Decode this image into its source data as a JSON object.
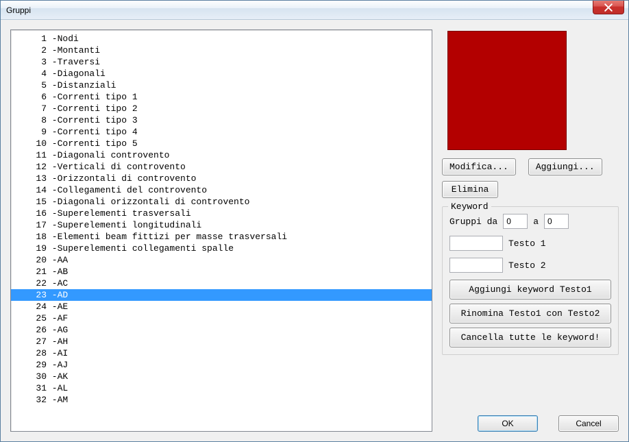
{
  "window": {
    "title": "Gruppi"
  },
  "list": {
    "items": [
      {
        "n": 1,
        "label": "-Nodi",
        "selected": false
      },
      {
        "n": 2,
        "label": "-Montanti",
        "selected": false
      },
      {
        "n": 3,
        "label": "-Traversi",
        "selected": false
      },
      {
        "n": 4,
        "label": "-Diagonali",
        "selected": false
      },
      {
        "n": 5,
        "label": "-Distanziali",
        "selected": false
      },
      {
        "n": 6,
        "label": "-Correnti tipo 1",
        "selected": false
      },
      {
        "n": 7,
        "label": "-Correnti tipo 2",
        "selected": false
      },
      {
        "n": 8,
        "label": "-Correnti tipo 3",
        "selected": false
      },
      {
        "n": 9,
        "label": "-Correnti tipo 4",
        "selected": false
      },
      {
        "n": 10,
        "label": "-Correnti tipo 5",
        "selected": false
      },
      {
        "n": 11,
        "label": "-Diagonali controvento",
        "selected": false
      },
      {
        "n": 12,
        "label": "-Verticali di controvento",
        "selected": false
      },
      {
        "n": 13,
        "label": "-Orizzontali di controvento",
        "selected": false
      },
      {
        "n": 14,
        "label": "-Collegamenti del controvento",
        "selected": false
      },
      {
        "n": 15,
        "label": "-Diagonali orizzontali di controvento",
        "selected": false
      },
      {
        "n": 16,
        "label": "-Superelementi trasversali",
        "selected": false
      },
      {
        "n": 17,
        "label": "-Superelementi longitudinali",
        "selected": false
      },
      {
        "n": 18,
        "label": "-Elementi beam fittizi per masse trasversali",
        "selected": false
      },
      {
        "n": 19,
        "label": "-Superelementi collegamenti spalle",
        "selected": false
      },
      {
        "n": 20,
        "label": "-AA",
        "selected": false
      },
      {
        "n": 21,
        "label": "-AB",
        "selected": false
      },
      {
        "n": 22,
        "label": "-AC",
        "selected": false
      },
      {
        "n": 23,
        "label": "-AD",
        "selected": true
      },
      {
        "n": 24,
        "label": "-AE",
        "selected": false
      },
      {
        "n": 25,
        "label": "-AF",
        "selected": false
      },
      {
        "n": 26,
        "label": "-AG",
        "selected": false
      },
      {
        "n": 27,
        "label": "-AH",
        "selected": false
      },
      {
        "n": 28,
        "label": "-AI",
        "selected": false
      },
      {
        "n": 29,
        "label": "-AJ",
        "selected": false
      },
      {
        "n": 30,
        "label": "-AK",
        "selected": false
      },
      {
        "n": 31,
        "label": "-AL",
        "selected": false
      },
      {
        "n": 32,
        "label": "-AM",
        "selected": false
      }
    ]
  },
  "color_swatch": "#b30000",
  "buttons": {
    "modify": "Modifica...",
    "add": "Aggiungi...",
    "delete": "Elimina",
    "ok": "OK",
    "cancel": "Cancel"
  },
  "keyword_panel": {
    "legend": "Keyword",
    "groups_from_label": "Gruppi da",
    "groups_to_label": "a",
    "groups_from_value": "0",
    "groups_to_value": "0",
    "text1_value": "",
    "text1_label": "Testo 1",
    "text2_value": "",
    "text2_label": "Testo 2",
    "btn_add_keyword": "Aggiungi keyword Testo1",
    "btn_rename": "Rinomina Testo1 con Testo2",
    "btn_delete_all": "Cancella tutte le keyword!"
  }
}
